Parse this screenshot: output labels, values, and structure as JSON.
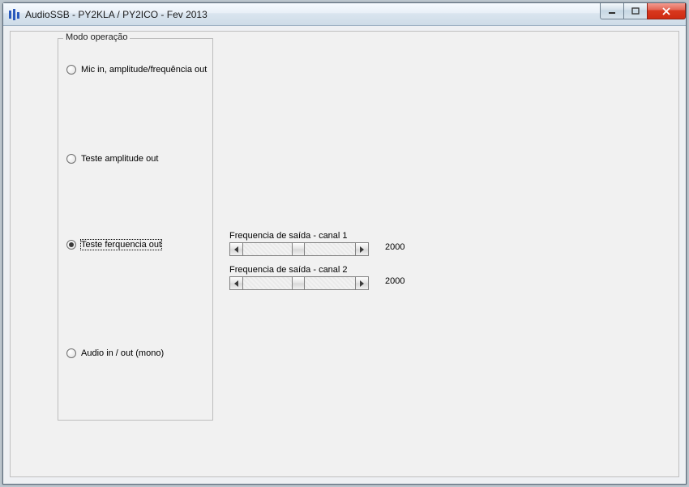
{
  "window": {
    "title": "AudioSSB - PY2KLA / PY2ICO - Fev 2013"
  },
  "groupbox": {
    "legend": "Modo operação"
  },
  "radios": {
    "mic_in": {
      "label": "Mic in, amplitude/frequência out",
      "checked": false
    },
    "test_amp": {
      "label": "Teste amplitude out",
      "checked": false
    },
    "test_freq": {
      "label": "Teste ferquencia out",
      "checked": true
    },
    "audio_io": {
      "label": "Audio in  / out (mono)",
      "checked": false
    }
  },
  "sliders": {
    "ch1": {
      "label": "Frequencia de saída - canal 1",
      "value": "2000"
    },
    "ch2": {
      "label": "Frequencia de saída - canal 2",
      "value": "2000"
    }
  }
}
